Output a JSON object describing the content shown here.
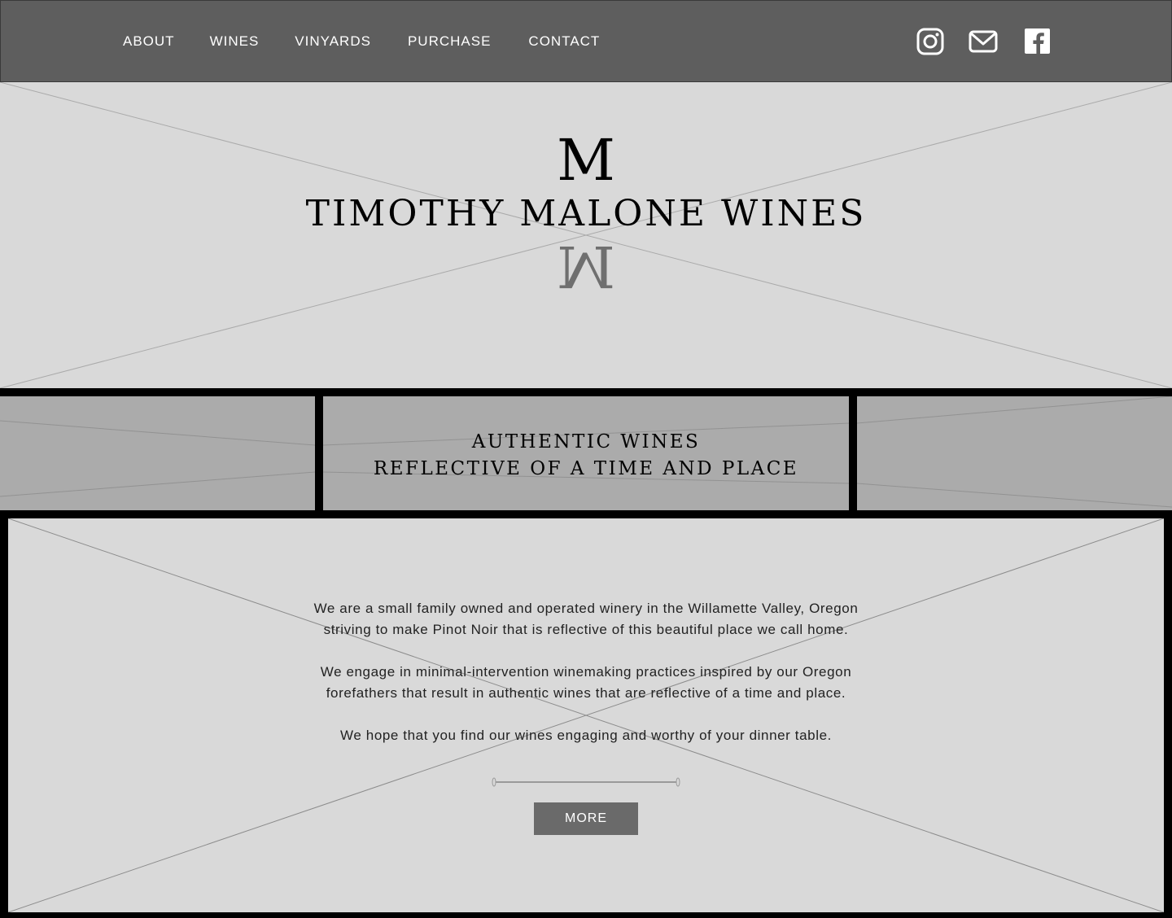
{
  "nav": {
    "links": [
      "ABOUT",
      "WINES",
      "VINYARDS",
      "PURCHASE",
      "CONTACT"
    ],
    "icons": [
      "instagram-icon",
      "mail-icon",
      "facebook-icon"
    ]
  },
  "hero": {
    "logo_letter": "M",
    "title": "TIMOTHY MALONE WINES"
  },
  "tagline": {
    "line1": "AUTHENTIC WINES",
    "line2": "REFLECTIVE OF A TIME AND PLACE"
  },
  "about": {
    "p1_line1": "We are a small family owned and operated winery in the Willamette Valley, Oregon",
    "p1_line2": "striving to make Pinot Noir that is reflective of this beautiful place we call home.",
    "p2_line1": "We engage in minimal-intervention winemaking practices inspired by our Oregon",
    "p2_line2": "forefathers that result in authentic wines that are reflective of a time and place.",
    "p3": "We hope that you find our wines engaging and worthy of your dinner table.",
    "more_label": "MORE"
  },
  "colors": {
    "nav_bg": "#5e5e5e",
    "hero_bg": "#d9d9d9",
    "band_bg": "#ababab",
    "button_bg": "#6a6a6a"
  }
}
